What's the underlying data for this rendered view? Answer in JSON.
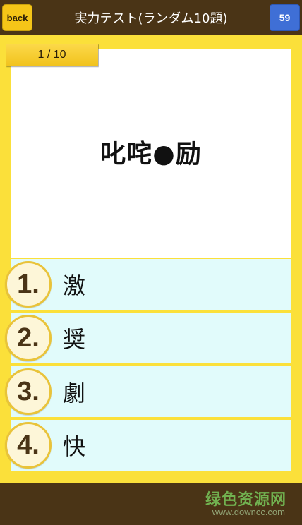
{
  "header": {
    "back_label": "back",
    "title": "実力テスト(ランダム10題)",
    "count": "59"
  },
  "progress": "1 / 10",
  "question": "叱咤●励",
  "choices": [
    {
      "number": "1.",
      "text": "激"
    },
    {
      "number": "2.",
      "text": "奨"
    },
    {
      "number": "3.",
      "text": "劇"
    },
    {
      "number": "4.",
      "text": "快"
    }
  ],
  "watermark": {
    "text": "绿色资源网",
    "url": "www.downcc.com"
  },
  "colors": {
    "header_bg": "#4a3416",
    "frame_yellow": "#fbe03a",
    "back_button": "#f5c518",
    "count_button": "#3f6fd6",
    "choice_bg": "#e1fbfb"
  }
}
